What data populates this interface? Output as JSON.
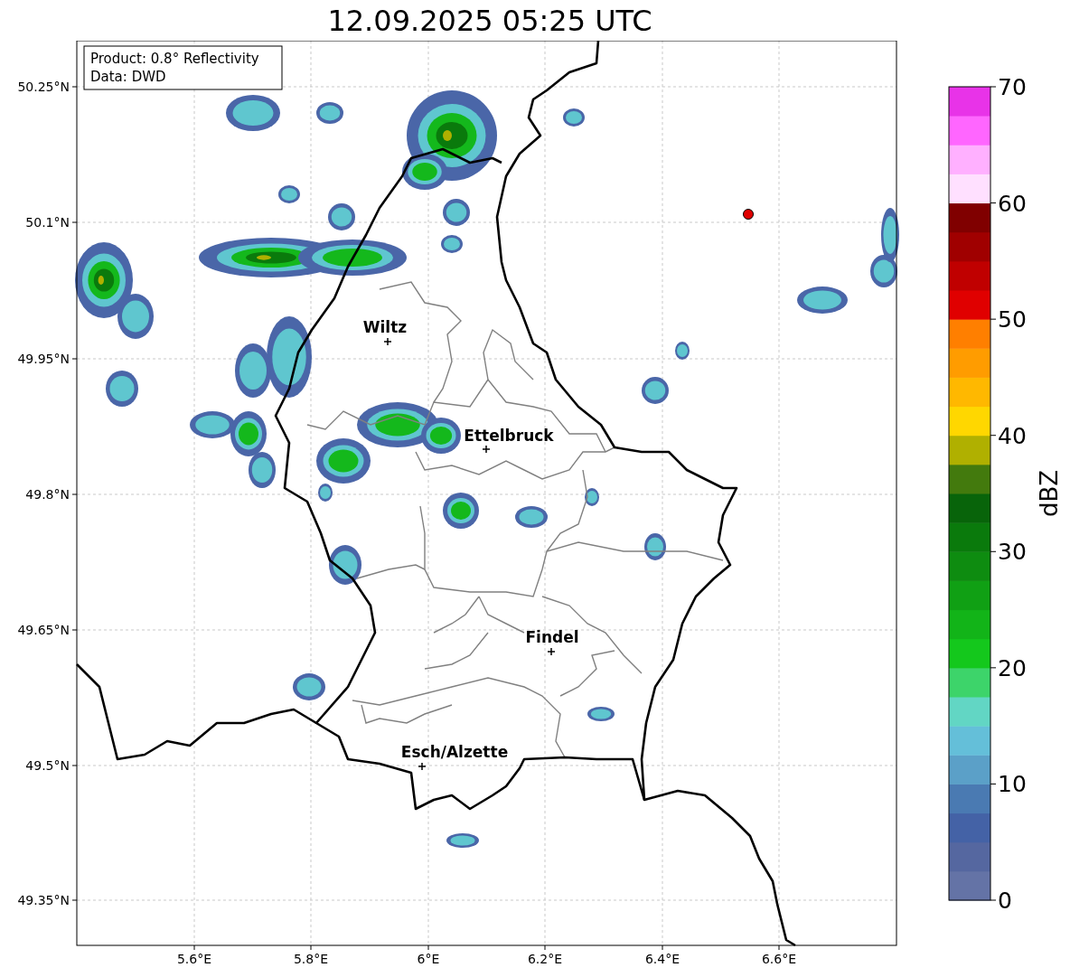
{
  "title": "12.09.2025 05:25 UTC",
  "info_box": {
    "lines": [
      "Product: 0.8° Reflectivity",
      "Data: DWD"
    ]
  },
  "map": {
    "x_ticks": [
      "5.6°E",
      "5.8°E",
      "6°E",
      "6.2°E",
      "6.4°E",
      "6.6°E"
    ],
    "y_ticks": [
      "50.25°N",
      "50.1°N",
      "49.95°N",
      "49.8°N",
      "49.65°N",
      "49.5°N",
      "49.35°N"
    ],
    "cities": [
      {
        "name": "Wiltz"
      },
      {
        "name": "Ettelbruck"
      },
      {
        "name": "Findel"
      },
      {
        "name": "Esch/Alzette"
      }
    ]
  },
  "colorbar": {
    "label": "dBZ",
    "ticks": [
      "70",
      "60",
      "50",
      "40",
      "30",
      "20",
      "10",
      "0"
    ],
    "bins": [
      {
        "color": "#6473a6"
      },
      {
        "color": "#5567a0"
      },
      {
        "color": "#4462a6"
      },
      {
        "color": "#4a7ab2"
      },
      {
        "color": "#5ba0c8"
      },
      {
        "color": "#64bfd9"
      },
      {
        "color": "#62d6c4"
      },
      {
        "color": "#3dd46a"
      },
      {
        "color": "#14c81c"
      },
      {
        "color": "#12b418"
      },
      {
        "color": "#10a014"
      },
      {
        "color": "#0e8c10"
      },
      {
        "color": "#0a7a0c"
      },
      {
        "color": "#08640a"
      },
      {
        "color": "#437a0d"
      },
      {
        "color": "#b0b000"
      },
      {
        "color": "#ffd700"
      },
      {
        "color": "#ffb800"
      },
      {
        "color": "#ff9c00"
      },
      {
        "color": "#ff7f00"
      },
      {
        "color": "#e00000"
      },
      {
        "color": "#c00000"
      },
      {
        "color": "#a00000"
      },
      {
        "color": "#800000"
      },
      {
        "color": "#ffe0ff"
      },
      {
        "color": "#ffb0ff"
      },
      {
        "color": "#ff66ff"
      },
      {
        "color": "#e833e8"
      }
    ]
  }
}
